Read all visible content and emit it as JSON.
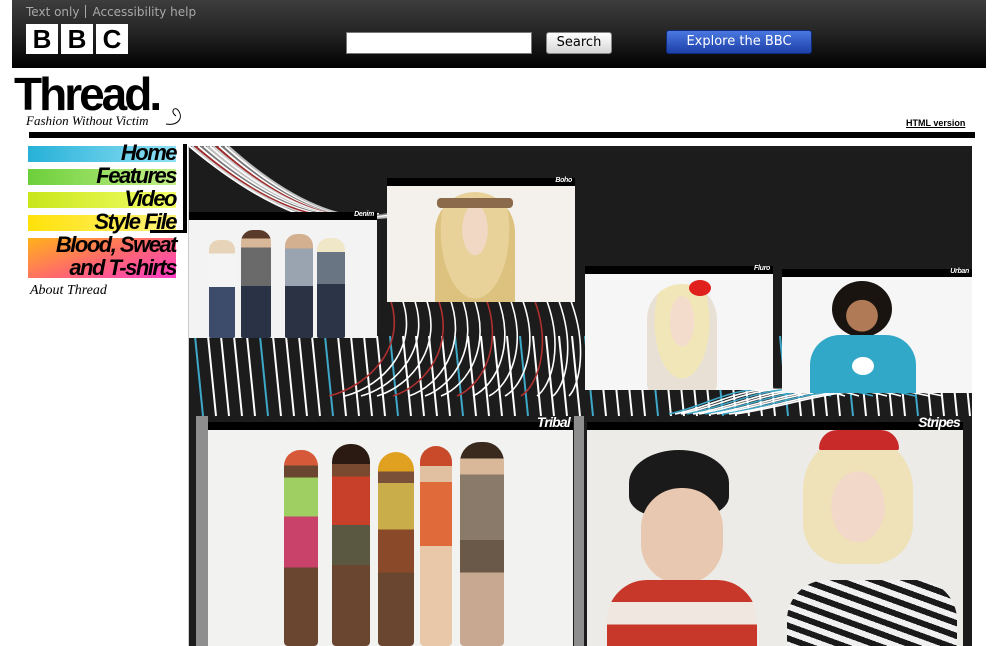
{
  "masthead": {
    "text_only": "Text only",
    "accessibility_help": "Accessibility help",
    "logo_letters": [
      "B",
      "B",
      "C"
    ],
    "search_value": "",
    "search_button": "Search",
    "explore_button": "Explore the BBC"
  },
  "brand": {
    "title": "Thread.",
    "tagline": "Fashion Without Victim",
    "html_version": "HTML version"
  },
  "nav": {
    "items": [
      {
        "label": "Home",
        "gradient": [
          "#27b1d8",
          "#8fe0f4"
        ]
      },
      {
        "label": "Features",
        "gradient": [
          "#6ccf3a",
          "#c6f08a"
        ]
      },
      {
        "label": "Video",
        "gradient": [
          "#c8e61a",
          "#f4ff6a"
        ]
      },
      {
        "label": "Style File",
        "gradient": [
          "#ffe20a",
          "#fff27a"
        ]
      },
      {
        "label": "Blood, Sweat and T-shirts",
        "gradient": [
          "#ff9a1a",
          "#ff3dc8"
        ]
      }
    ],
    "about": "About Thread"
  },
  "collage": {
    "photos": [
      {
        "caption": "Denim",
        "bg": "#f3f3f3"
      },
      {
        "caption": "Boho",
        "bg": "#f4f1ec"
      },
      {
        "caption": "Fluro",
        "bg": "#f6f6f6"
      },
      {
        "caption": "Urban",
        "bg": "#f6f6f6"
      },
      {
        "caption": "Tribal",
        "bg": "#f2f2f0"
      },
      {
        "caption": "Stripes",
        "bg": "#ecebe8"
      }
    ]
  },
  "colors": {
    "masthead_top": "#3d3d3d",
    "masthead_bottom": "#000000",
    "explore_blue": "#1c40a8",
    "collage_bg": "#1c1c1c"
  }
}
